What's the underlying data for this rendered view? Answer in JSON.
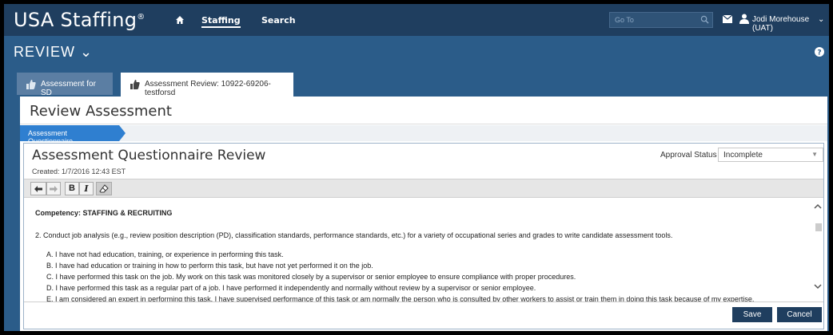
{
  "header": {
    "logo": "USA Staffing",
    "logo_mark": "®",
    "nav": {
      "staffing": "Staffing",
      "search": "Search"
    },
    "goto_placeholder": "Go To",
    "user": "Jodi Morehouse (UAT)",
    "caret": "⌄"
  },
  "section": {
    "title": "REVIEW ⌄"
  },
  "tabs": [
    {
      "label": "Assessment for SD"
    },
    {
      "label": "Assessment Review: 10922-69206-testforsd"
    }
  ],
  "panel": {
    "title": "Review Assessment",
    "breadcrumb": "Assessment Questionnaire"
  },
  "review": {
    "title": "Assessment Questionnaire Review",
    "created": "Created: 1/7/2016 12:43 EST",
    "approval_label": "Approval Status",
    "approval_value": "Incomplete",
    "approval_caret": "▼"
  },
  "toolbar": {
    "bold": "B",
    "italic": "I"
  },
  "content": {
    "competency": "Competency: STAFFING & RECRUITING",
    "question": "2. Conduct job analysis (e.g., review position description (PD), classification standards, performance standards, etc.) for a variety of occupational series and grades to write candidate assessment tools.",
    "options": [
      "A. I have not had education, training, or experience in performing this task.",
      "B. I have had education or training in how to perform this task, but have not yet performed it on the job.",
      "C. I have performed this task on the job. My work on this task was monitored closely by a supervisor or senior employee to ensure compliance with proper procedures.",
      "D. I have performed this task as a regular part of a job. I have performed it independently and normally without review by a supervisor or senior employee.",
      "E. I am considered an expert in performing this task. I have supervised performance of this task or am normally the person who is consulted by other workers to assist or train them in doing this task because of my expertise."
    ]
  },
  "footer": {
    "save": "Save",
    "cancel": "Cancel"
  },
  "colors": {
    "header_bg": "#1f3e5f",
    "section_bg": "#2b5c89",
    "accent": "#2f7fd0",
    "button_bg": "#1f3e5f"
  }
}
